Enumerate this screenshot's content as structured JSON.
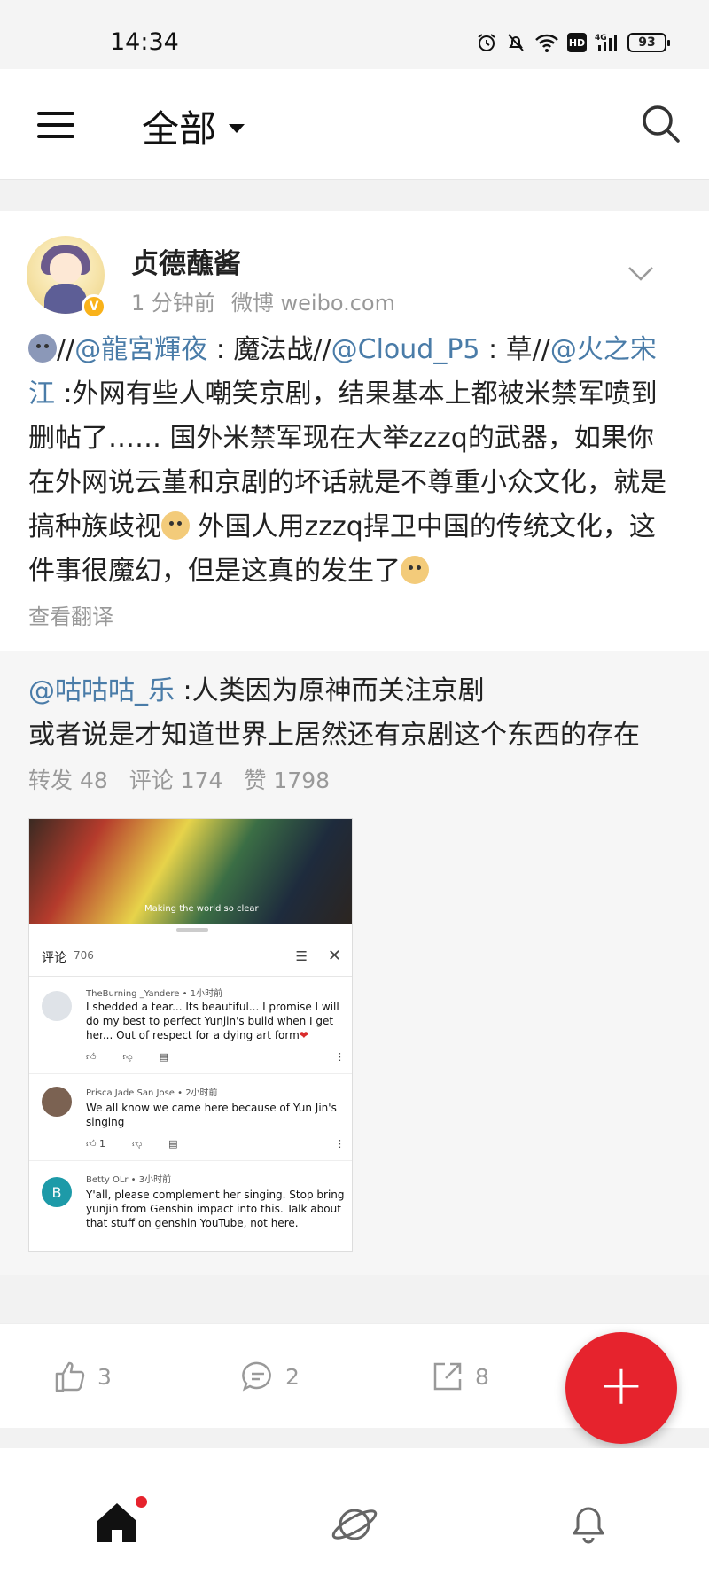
{
  "status_bar": {
    "time": "14:34",
    "battery": "93",
    "network": "HD",
    "signal_label": "4G"
  },
  "header": {
    "filter_label": "全部",
    "icons": [
      "menu-icon",
      "chevron-down-icon",
      "search-icon"
    ]
  },
  "post": {
    "author": "贞德蘸酱",
    "time_ago": "1 分钟前",
    "source": "微博 weibo.com",
    "verified_badge": "V",
    "text": {
      "sep1": "//",
      "m1": "@龍宮輝夜",
      "t1": " : 魔法战//",
      "m2": "@Cloud_P5",
      "t2": " : 草//",
      "m3": "@火之宋江",
      "t3": " :外网有些人嘲笑京剧，结果基本上都被米禁军喷到删帖了…… 国外米禁军现在大举zzzq的武器，如果你在外网说云堇和京剧的坏话就是不尊重小众文化，就是搞种族歧视",
      "t4": " 外国人用zzzq捍卫中国的传统文化，这件事很魔幻，但是这真的发生了"
    },
    "translate_label": "查看翻译"
  },
  "repost": {
    "mention": "@咕咕咕_乐",
    "text1": " :人类因为原神而关注京剧",
    "text2": "或者说是才知道世界上居然还有京剧这个东西的存在",
    "stats": {
      "reposts": "转发 48",
      "comments": "评论 174",
      "likes": "赞 1798"
    }
  },
  "screenshot": {
    "video_caption": "Making the world so clear",
    "title": "评论",
    "count": "706",
    "comments": [
      {
        "author": "TheBurning _Yandere • 1小时前",
        "body": "I shedded a tear... Its beautiful... I promise I will do my best to perfect Yunjin's build when I get her... Out of respect for a dying art form",
        "likes": ""
      },
      {
        "author": "Prisca Jade San Jose • 2小时前",
        "body": "We all know we came here because of Yun Jin's singing",
        "likes": "1"
      },
      {
        "author": "Betty OLr • 3小时前",
        "avatar_letter": "B",
        "body": "Y'all, please complement her singing. Stop bring yunjin from Genshin impact into this. Talk about that stuff on genshin YouTube, not here.",
        "likes": ""
      }
    ]
  },
  "actions": {
    "like_count": "3",
    "comment_count": "2",
    "share_count": "8",
    "fab_label": "+"
  },
  "colors": {
    "accent": "#e6232d",
    "link": "#4a7ca8",
    "muted": "#999999"
  }
}
